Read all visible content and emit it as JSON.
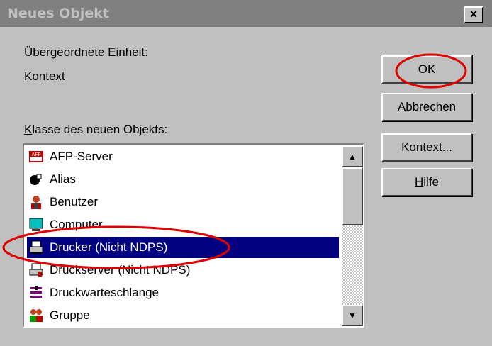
{
  "window": {
    "title": "Neues Objekt",
    "close_label": "×"
  },
  "parent": {
    "label": "Übergeordnete Einheit:",
    "value": "Kontext"
  },
  "class_list": {
    "label_first": "K",
    "label_rest": "lasse des neuen Objekts:",
    "items": [
      {
        "label": "AFP-Server",
        "icon": "afp-server-icon"
      },
      {
        "label": "Alias",
        "icon": "alias-icon"
      },
      {
        "label": "Benutzer",
        "icon": "user-icon"
      },
      {
        "label": "Computer",
        "icon": "computer-icon"
      },
      {
        "label": "Drucker (Nicht NDPS)",
        "icon": "printer-icon",
        "selected": true
      },
      {
        "label": "Druckserver (Nicht NDPS)",
        "icon": "print-server-icon"
      },
      {
        "label": "Druckwarteschlange",
        "icon": "print-queue-icon"
      },
      {
        "label": "Gruppe",
        "icon": "group-icon"
      }
    ]
  },
  "buttons": {
    "ok": "OK",
    "cancel": "Abbrechen",
    "context_pre": "K",
    "context_u": "o",
    "context_post": "ntext...",
    "help_u": "H",
    "help_post": "ilfe"
  },
  "colors": {
    "selection": "#000080",
    "dialog": "#c0c0c0",
    "titlebar": "#808080",
    "annotation": "#e00000"
  }
}
